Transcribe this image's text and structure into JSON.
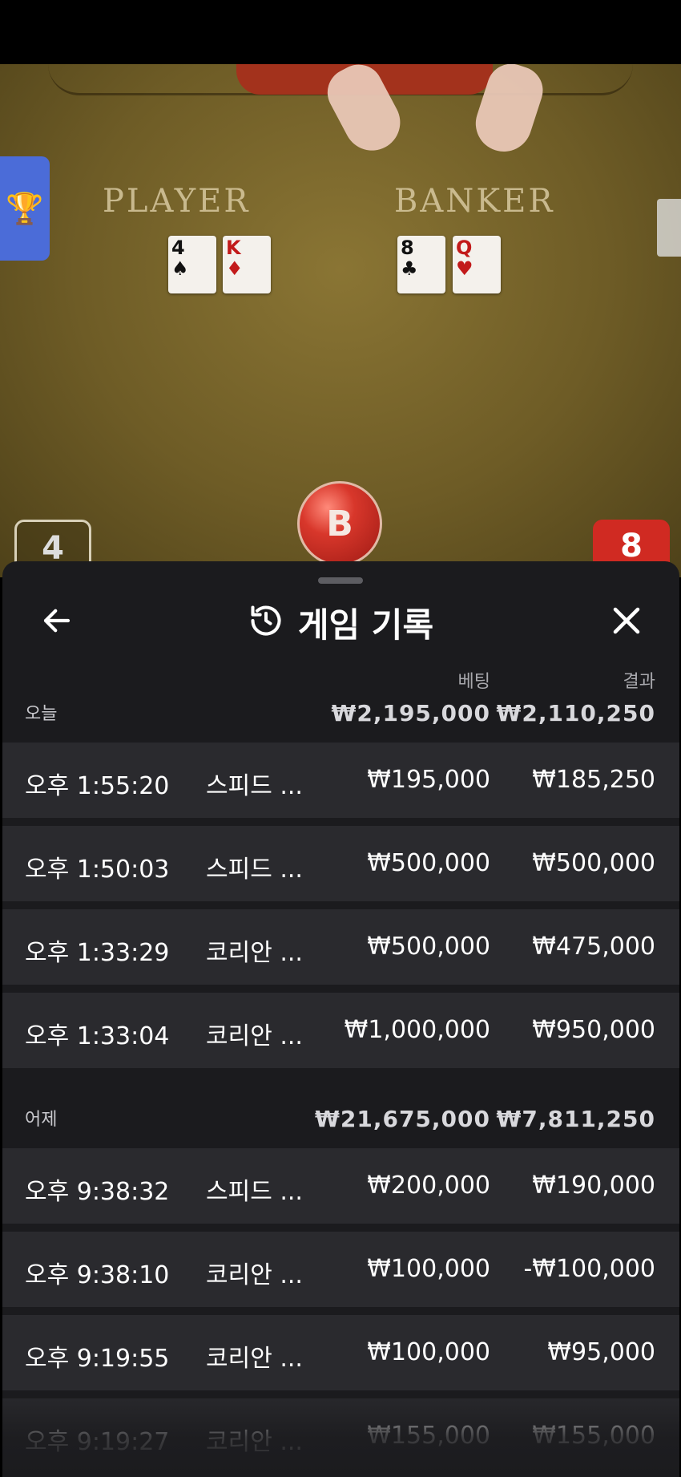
{
  "table": {
    "player_label": "PLAYER",
    "banker_label": "BANKER",
    "player_cards": [
      {
        "rank": "4",
        "suit": "♠",
        "color": "black"
      },
      {
        "rank": "K",
        "suit": "♦",
        "color": "red"
      }
    ],
    "banker_cards": [
      {
        "rank": "8",
        "suit": "♣",
        "color": "black"
      },
      {
        "rank": "Q",
        "suit": "♥",
        "color": "red"
      }
    ],
    "result_badge": "B",
    "player_score": "4",
    "banker_score": "8"
  },
  "sheet": {
    "title": "게임 기록",
    "col_bet": "베팅",
    "col_result": "결과",
    "groups": [
      {
        "day": "오늘",
        "total_bet": "₩2,195,000",
        "total_result": "₩2,110,250",
        "rows": [
          {
            "time": "오후 1:55:20",
            "game": "스피드 ...",
            "bet": "₩195,000",
            "result": "₩185,250"
          },
          {
            "time": "오후 1:50:03",
            "game": "스피드 ...",
            "bet": "₩500,000",
            "result": "₩500,000"
          },
          {
            "time": "오후 1:33:29",
            "game": "코리안 ...",
            "bet": "₩500,000",
            "result": "₩475,000"
          },
          {
            "time": "오후 1:33:04",
            "game": "코리안 ...",
            "bet": "₩1,000,000",
            "result": "₩950,000"
          }
        ]
      },
      {
        "day": "어제",
        "total_bet": "₩21,675,000",
        "total_result": "₩7,811,250",
        "rows": [
          {
            "time": "오후 9:38:32",
            "game": "스피드 ...",
            "bet": "₩200,000",
            "result": "₩190,000"
          },
          {
            "time": "오후 9:38:10",
            "game": "코리안 ...",
            "bet": "₩100,000",
            "result": "-₩100,000"
          },
          {
            "time": "오후 9:19:55",
            "game": "코리안 ...",
            "bet": "₩100,000",
            "result": "₩95,000"
          },
          {
            "time": "오후 9:19:27",
            "game": "코리안 ...",
            "bet": "₩155,000",
            "result": "₩155,000"
          }
        ]
      }
    ]
  },
  "colors": {
    "sheet_bg": "#1b1b1e",
    "row_bg": "#2a2a2e",
    "banker_red": "#d02a22",
    "trophy_tab": "#4b6cd8"
  },
  "icons": {
    "back": "arrow-left-icon",
    "history": "history-icon",
    "close": "close-icon",
    "trophy": "trophy-icon"
  }
}
